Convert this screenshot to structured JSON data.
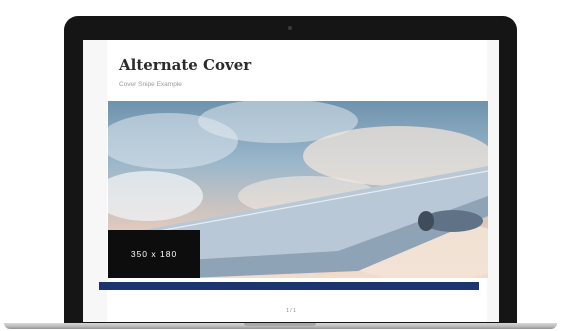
{
  "cover": {
    "title": "Alternate Cover",
    "subtitle": "Cover Snipe Example",
    "placeholder_label": "350 x 180"
  },
  "pager": {
    "label": "1 / 1"
  },
  "colors": {
    "accent_bar": "#1c356e",
    "bezel": "#151515",
    "placeholder_bg": "#0d0d0d"
  },
  "icons": {
    "camera": "webcam-dot"
  }
}
